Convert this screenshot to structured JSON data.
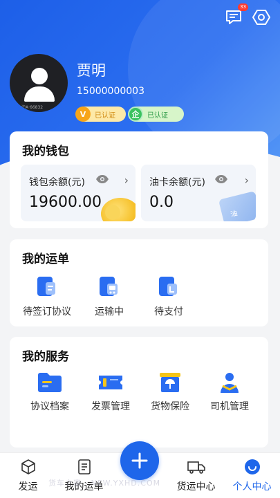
{
  "header": {
    "notification_count": "33"
  },
  "profile": {
    "name": "贾明",
    "phone": "15000000003",
    "avatar_caption": "沪A·66832",
    "badges": [
      {
        "icon_text": "V",
        "label": "已认证"
      },
      {
        "icon_text": "企",
        "label": "已认证"
      }
    ]
  },
  "wallet": {
    "title": "我的钱包",
    "items": [
      {
        "label": "钱包余额(元)",
        "amount": "19600.00"
      },
      {
        "label": "油卡余额(元)",
        "amount": "0.0",
        "card_text": "油"
      }
    ]
  },
  "orders": {
    "title": "我的运单",
    "items": [
      {
        "label": "待签订协议",
        "icon": "sign-document-icon"
      },
      {
        "label": "运输中",
        "icon": "truck-document-icon"
      },
      {
        "label": "待支付",
        "icon": "payment-document-icon"
      }
    ]
  },
  "services": {
    "title": "我的服务",
    "items": [
      {
        "label": "协议档案",
        "icon": "folder-icon"
      },
      {
        "label": "发票管理",
        "icon": "ticket-icon"
      },
      {
        "label": "货物保险",
        "icon": "insured-box-icon"
      },
      {
        "label": "司机管理",
        "icon": "driver-icon"
      }
    ]
  },
  "tabbar": {
    "items": [
      {
        "label": "发运",
        "icon": "package-icon"
      },
      {
        "label": "我的运单",
        "icon": "list-document-icon"
      },
      {
        "label": "货运中心",
        "icon": "truck-icon"
      },
      {
        "label": "个人中心",
        "icon": "profile-icon",
        "active": true
      }
    ]
  },
  "watermark": "货车之家 · NEW.YXHD.COM",
  "colors": {
    "primary": "#1e66ea",
    "icon_blue": "#2a6df1",
    "icon_yellow": "#f5c518"
  }
}
